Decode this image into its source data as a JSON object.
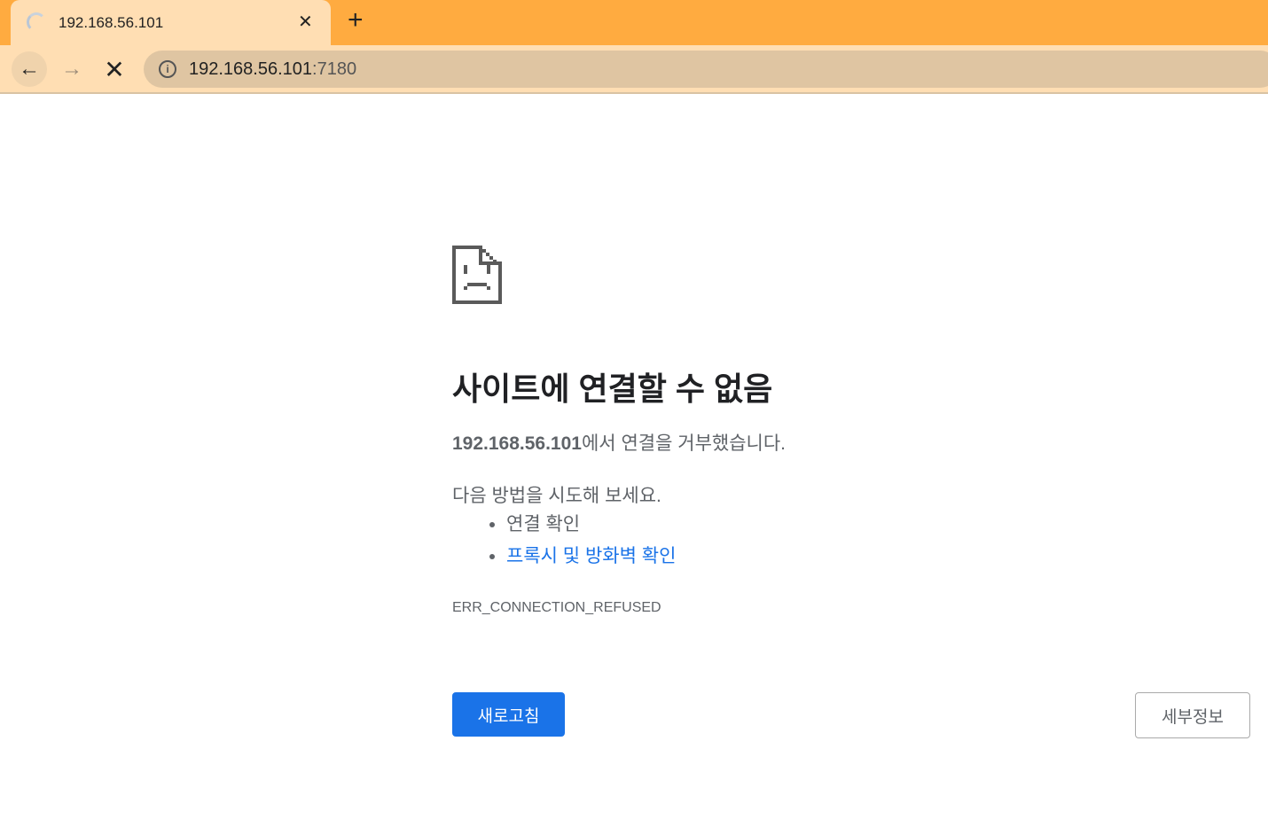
{
  "tab": {
    "title": "192.168.56.101",
    "close": "✕",
    "new_tab": "+"
  },
  "toolbar": {
    "back": "←",
    "forward": "→",
    "stop": "✕",
    "info": "i",
    "url_host": "192.168.56.101",
    "url_port": ":7180"
  },
  "error": {
    "heading": "사이트에 연결할 수 없음",
    "host": "192.168.56.101",
    "description_suffix": "에서 연결을 거부했습니다.",
    "try_label": "다음 방법을 시도해 보세요.",
    "suggestions": [
      "연결 확인",
      "프록시 및 방화벽 확인"
    ],
    "code": "ERR_CONNECTION_REFUSED",
    "reload_label": "새로고침",
    "details_label": "세부정보"
  },
  "colors": {
    "tabstrip": "#ffab40",
    "toolbar": "#ffdeb3",
    "accent": "#1a73e8"
  }
}
